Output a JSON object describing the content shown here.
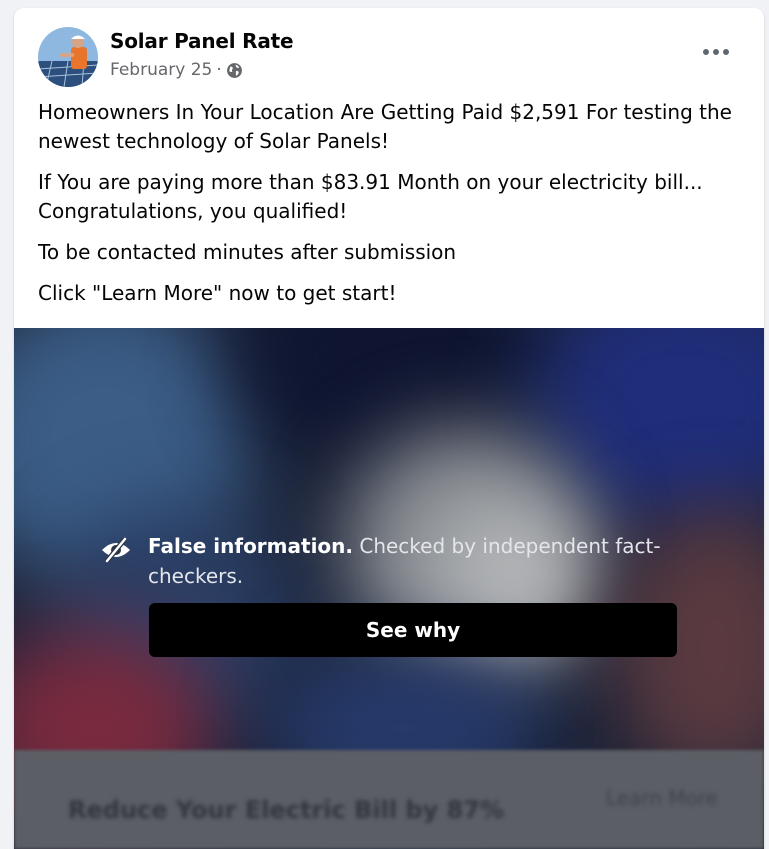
{
  "post": {
    "page_name": "Solar Panel Rate",
    "date": "February 25",
    "separator": "·",
    "audience_icon": "globe-icon",
    "more_icon": "more-options-icon",
    "paragraphs": [
      "Homeowners In Your Location Are Getting Paid $2,591 For testing the newest technology of Solar Panels!",
      "If You are paying more than $83.91 Month on your electricity bill... Congratulations, you qualified!",
      "To be contacted minutes after submission",
      "Click \"Learn More\" now to get start!"
    ]
  },
  "fact_check": {
    "icon": "eye-slash-icon",
    "label_bold": "False information.",
    "label_rest": " Checked by independent fact-checkers.",
    "button_label": "See why"
  },
  "cta": {
    "headline": "Reduce Your Electric Bill by 87%",
    "button_label": "Learn More"
  },
  "colors": {
    "card_bg": "#ffffff",
    "page_bg": "#f0f2f5",
    "text": "#050505",
    "secondary_text": "#65676b",
    "see_why_bg": "#000000"
  }
}
